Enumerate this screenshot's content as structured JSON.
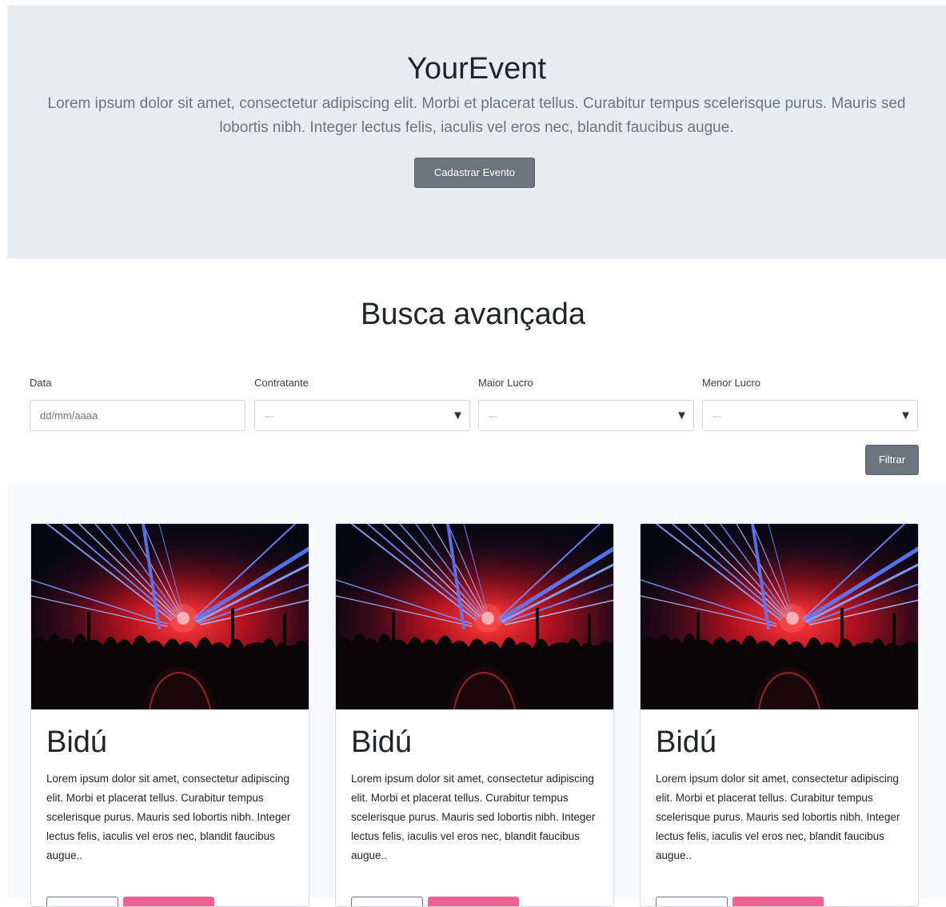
{
  "hero": {
    "title": "YourEvent",
    "description": "Lorem ipsum dolor sit amet, consectetur adipiscing elit. Morbi et placerat tellus. Curabitur tempus scelerisque purus. Mauris sed lobortis nibh. Integer lectus felis, iaculis vel eros nec, blandit faucibus augue.",
    "button_label": "Cadastrar Evento"
  },
  "search": {
    "title": "Busca avançada",
    "fields": [
      {
        "label": "Data",
        "placeholder": "dd/mm/aaaa"
      },
      {
        "label": "Contratante",
        "value": "---"
      },
      {
        "label": "Maior Lucro",
        "value": "---"
      },
      {
        "label": "Menor Lucro",
        "value": "---"
      }
    ],
    "filter_label": "Filtrar"
  },
  "cards": [
    {
      "title": "Bidú",
      "text": "Lorem ipsum dolor sit amet, consectetur adipiscing elit. Morbi et placerat tellus. Curabitur tempus scelerisque purus. Mauris sed lobortis nibh. Integer lectus felis, iaculis vel eros nec, blandit faucibus augue.."
    },
    {
      "title": "Bidú",
      "text": "Lorem ipsum dolor sit amet, consectetur adipiscing elit. Morbi et placerat tellus. Curabitur tempus scelerisque purus. Mauris sed lobortis nibh. Integer lectus felis, iaculis vel eros nec, blandit faucibus augue.."
    },
    {
      "title": "Bidú",
      "text": "Lorem ipsum dolor sit amet, consectetur adipiscing elit. Morbi et placerat tellus. Curabitur tempus scelerisque purus. Mauris sed lobortis nibh. Integer lectus felis, iaculis vel eros nec, blandit faucibus augue.."
    }
  ],
  "colors": {
    "hero_bg": "#e9ecef",
    "button_secondary": "#6c757d",
    "card_button_accent": "#f06292"
  }
}
